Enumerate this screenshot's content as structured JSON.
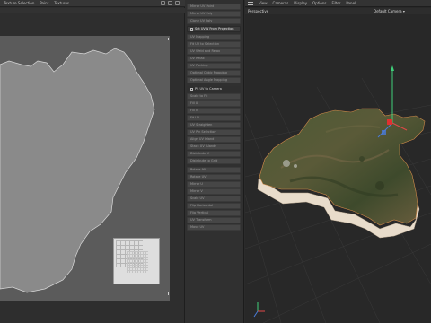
{
  "uv_editor": {
    "menu": [
      "Texture Selection",
      "Paint",
      "Textures"
    ]
  },
  "commands": {
    "items": [
      {
        "label": "Mirror UV Point",
        "state": "dim"
      },
      {
        "label": "Mirror UV Poly",
        "state": "dim"
      },
      {
        "label": "Clone UV Poly",
        "state": "dim"
      },
      {
        "label": "Set UVW From Projection",
        "state": "highlight"
      },
      {
        "label": "UV Mapping",
        "state": "dim"
      },
      {
        "label": "Fit UV to Selection",
        "state": "dim"
      },
      {
        "label": "UV Weld and Relax",
        "state": "dim"
      },
      {
        "label": "UV Relax",
        "state": "dim"
      },
      {
        "label": "UV Packing",
        "state": "dim"
      },
      {
        "label": "Optimal Cubic Mapping",
        "state": "dim"
      },
      {
        "label": "Optimal Angle Mapping",
        "state": "dim"
      },
      {
        "label": "Realign",
        "state": "dim"
      },
      {
        "label": "PS UV to Camera",
        "state": "header"
      },
      {
        "label": "Scale to Fit",
        "state": "dim"
      },
      {
        "label": "Fill U",
        "state": "dim"
      },
      {
        "label": "Fill V",
        "state": "dim"
      },
      {
        "label": "Fit UV",
        "state": "dim"
      },
      {
        "label": "UV Straighten",
        "state": "dim"
      },
      {
        "label": "UV Pin Selection",
        "state": "dim"
      },
      {
        "label": "Align UV Island",
        "state": "dim"
      },
      {
        "label": "Stack UV Islands",
        "state": "dim"
      },
      {
        "label": "Distribute X",
        "state": "dim"
      },
      {
        "label": "Distribute to Grid",
        "state": "dim"
      },
      {
        "label": "Distribute Y",
        "state": "dim"
      },
      {
        "label": "Rotate 90",
        "state": "dim"
      },
      {
        "label": "Rotate UV",
        "state": "dim"
      },
      {
        "label": "Mirror U",
        "state": "dim"
      },
      {
        "label": "Mirror V",
        "state": "dim"
      },
      {
        "label": "Scale UV",
        "state": "dim"
      },
      {
        "label": "Flip Horizontal",
        "state": "dim"
      },
      {
        "label": "Flip Vertical",
        "state": "dim"
      },
      {
        "label": "UV Transform",
        "state": "dim"
      },
      {
        "label": "Move UV",
        "state": "dim"
      },
      {
        "label": "Mirror UV",
        "state": "dim"
      },
      {
        "label": "Rotate UV",
        "state": "dim"
      }
    ]
  },
  "viewport": {
    "menu": [
      "View",
      "Cameras",
      "Display",
      "Options",
      "Filter",
      "Panel"
    ],
    "view_label": "Perspective",
    "camera_label": "Default Camera ▾"
  }
}
